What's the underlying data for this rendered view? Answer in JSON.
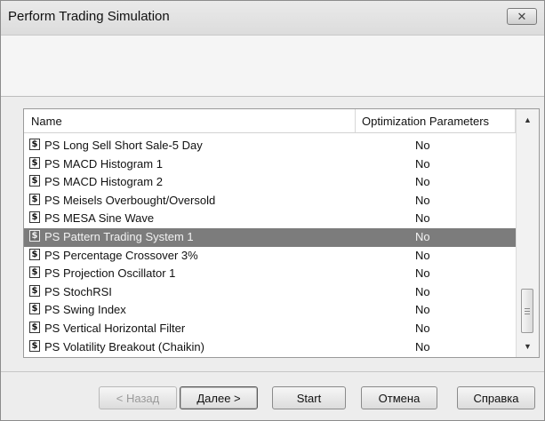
{
  "window": {
    "title": "Perform Trading Simulation",
    "close_icon": "✕"
  },
  "list": {
    "columns": {
      "name": "Name",
      "optimization": "Optimization Parameters"
    },
    "selected_index": 5,
    "rows": [
      {
        "name": "PS Long Sell Short Sale-5 Day",
        "optimization": "No"
      },
      {
        "name": "PS MACD Histogram 1",
        "optimization": "No"
      },
      {
        "name": "PS MACD Histogram 2",
        "optimization": "No"
      },
      {
        "name": "PS Meisels Overbought/Oversold",
        "optimization": "No"
      },
      {
        "name": "PS MESA Sine Wave",
        "optimization": "No"
      },
      {
        "name": "PS Pattern Trading System 1",
        "optimization": "No"
      },
      {
        "name": "PS Percentage Crossover 3%",
        "optimization": "No"
      },
      {
        "name": "PS Projection Oscillator 1",
        "optimization": "No"
      },
      {
        "name": "PS StochRSI",
        "optimization": "No"
      },
      {
        "name": "PS Swing Index",
        "optimization": "No"
      },
      {
        "name": "PS Vertical Horizontal Filter",
        "optimization": "No"
      },
      {
        "name": "PS Volatility Breakout (Chaikin)",
        "optimization": "No"
      }
    ],
    "row_icon": "$"
  },
  "buttons": {
    "back": "< Назад",
    "next": "Далее >",
    "start": "Start",
    "cancel": "Отмена",
    "help": "Справка"
  },
  "icons": {
    "row": "dollar-sign-icon",
    "close": "close-icon",
    "scroll_up": "chevron-up-icon",
    "scroll_down": "chevron-down-icon"
  }
}
